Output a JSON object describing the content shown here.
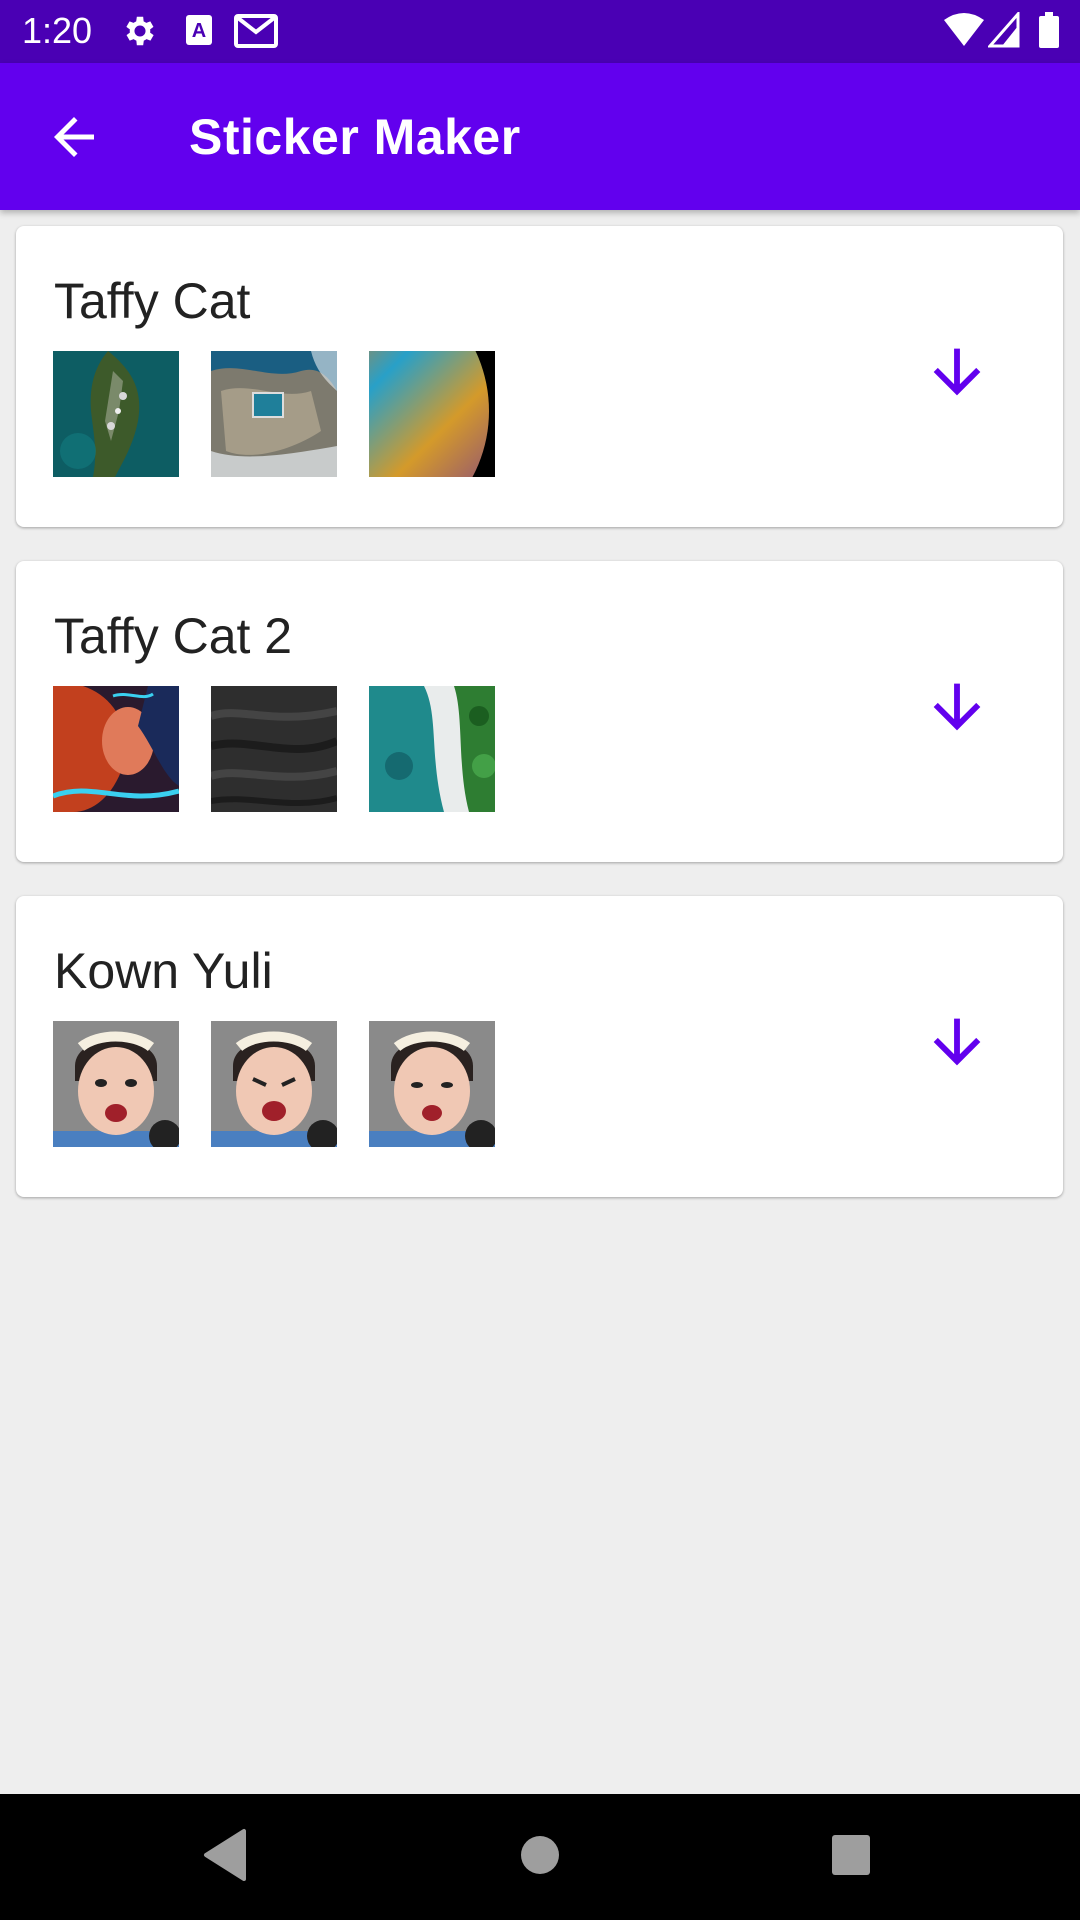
{
  "status_bar": {
    "time": "1:20",
    "icons": [
      "settings-gear-icon",
      "text-a-icon",
      "gmail-icon",
      "wifi-icon",
      "cellular-signal-icon",
      "battery-icon"
    ]
  },
  "app_bar": {
    "title": "Sticker Maker",
    "back_icon": "arrow-back-icon",
    "background": "#6200ee"
  },
  "packs": [
    {
      "name": "Taffy Cat",
      "stickers": [
        "island-aerial",
        "coast-pool-aerial",
        "colorful-planet"
      ],
      "action_icon": "download-arrow-icon"
    },
    {
      "name": "Taffy Cat 2",
      "stickers": [
        "neon-woman",
        "dark-sand",
        "beach-forest-aerial"
      ],
      "action_icon": "download-arrow-icon"
    },
    {
      "name": "Kown Yuli",
      "stickers": [
        "angry-girl-1",
        "angry-girl-2",
        "angry-girl-3"
      ],
      "action_icon": "download-arrow-icon"
    }
  ],
  "colors": {
    "accent": "#6200ee",
    "status_bar": "#4a00b4",
    "background": "#eeeeee"
  },
  "nav_bar": {
    "icons": [
      "back-triangle-icon",
      "home-circle-icon",
      "recents-square-icon"
    ]
  }
}
